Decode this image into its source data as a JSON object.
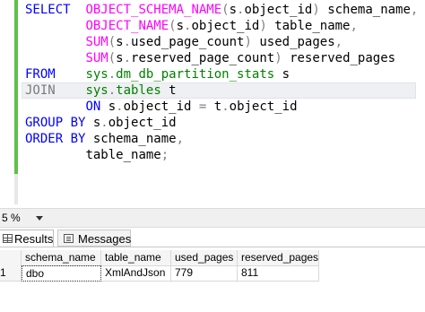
{
  "editor": {
    "lines": [
      [
        {
          "t": "SELECT  ",
          "c": "kw"
        },
        {
          "t": "OBJECT_SCHEMA_NAME",
          "c": "fn"
        },
        {
          "t": "(",
          "c": "op"
        },
        {
          "t": "s",
          "c": "id"
        },
        {
          "t": ".",
          "c": "op"
        },
        {
          "t": "object_id",
          "c": "id"
        },
        {
          "t": ")",
          "c": "op"
        },
        {
          "t": " schema_name",
          "c": "id"
        },
        {
          "t": ",",
          "c": "op"
        }
      ],
      [
        {
          "t": "        ",
          "c": "id"
        },
        {
          "t": "OBJECT_NAME",
          "c": "fn"
        },
        {
          "t": "(",
          "c": "op"
        },
        {
          "t": "s",
          "c": "id"
        },
        {
          "t": ".",
          "c": "op"
        },
        {
          "t": "object_id",
          "c": "id"
        },
        {
          "t": ")",
          "c": "op"
        },
        {
          "t": " table_name",
          "c": "id"
        },
        {
          "t": ",",
          "c": "op"
        }
      ],
      [
        {
          "t": "        ",
          "c": "id"
        },
        {
          "t": "SUM",
          "c": "fn"
        },
        {
          "t": "(",
          "c": "op"
        },
        {
          "t": "s",
          "c": "id"
        },
        {
          "t": ".",
          "c": "op"
        },
        {
          "t": "used_page_count",
          "c": "id"
        },
        {
          "t": ")",
          "c": "op"
        },
        {
          "t": " used_pages",
          "c": "id"
        },
        {
          "t": ",",
          "c": "op"
        }
      ],
      [
        {
          "t": "        ",
          "c": "id"
        },
        {
          "t": "SUM",
          "c": "fn"
        },
        {
          "t": "(",
          "c": "op"
        },
        {
          "t": "s",
          "c": "id"
        },
        {
          "t": ".",
          "c": "op"
        },
        {
          "t": "reserved_page_count",
          "c": "id"
        },
        {
          "t": ")",
          "c": "op"
        },
        {
          "t": " reserved_pages",
          "c": "id"
        }
      ],
      [
        {
          "t": "FROM    ",
          "c": "kw"
        },
        {
          "t": "sys",
          "c": "sy"
        },
        {
          "t": ".",
          "c": "op"
        },
        {
          "t": "dm_db_partition_stats",
          "c": "sy"
        },
        {
          "t": " s",
          "c": "id"
        }
      ],
      [
        {
          "t": "JOIN    ",
          "c": "gy"
        },
        {
          "t": "sys",
          "c": "sy"
        },
        {
          "t": ".",
          "c": "op"
        },
        {
          "t": "tables",
          "c": "sy"
        },
        {
          "t": " t",
          "c": "id"
        }
      ],
      [
        {
          "t": "        ",
          "c": "id"
        },
        {
          "t": "ON ",
          "c": "kw"
        },
        {
          "t": "s",
          "c": "id"
        },
        {
          "t": ".",
          "c": "op"
        },
        {
          "t": "object_id",
          "c": "id"
        },
        {
          "t": " = ",
          "c": "op"
        },
        {
          "t": "t",
          "c": "id"
        },
        {
          "t": ".",
          "c": "op"
        },
        {
          "t": "object_id",
          "c": "id"
        }
      ],
      [
        {
          "t": "GROUP BY ",
          "c": "kw"
        },
        {
          "t": "s",
          "c": "id"
        },
        {
          "t": ".",
          "c": "op"
        },
        {
          "t": "object_id",
          "c": "id"
        }
      ],
      [
        {
          "t": "ORDER BY ",
          "c": "kw"
        },
        {
          "t": "schema_name",
          "c": "id"
        },
        {
          "t": ",",
          "c": "op"
        }
      ],
      [
        {
          "t": "        ",
          "c": "id"
        },
        {
          "t": "table_name",
          "c": "id"
        },
        {
          "t": ";",
          "c": "op"
        }
      ]
    ],
    "highlighted_line": 5
  },
  "zoom": {
    "value": "5 %"
  },
  "tabs": {
    "results": "Results",
    "messages": "Messages"
  },
  "grid": {
    "columns": [
      "schema_name",
      "table_name",
      "used_pages",
      "reserved_pages"
    ],
    "rows": [
      {
        "rownum": "1",
        "cells": [
          "dbo",
          "XmlAndJson",
          "779",
          "811"
        ]
      }
    ]
  },
  "colors": {
    "keyword": "#0000ff",
    "function": "#ff00ff",
    "system_object": "#008000",
    "operator": "#808080",
    "change_bar": "#5fbf4a"
  }
}
